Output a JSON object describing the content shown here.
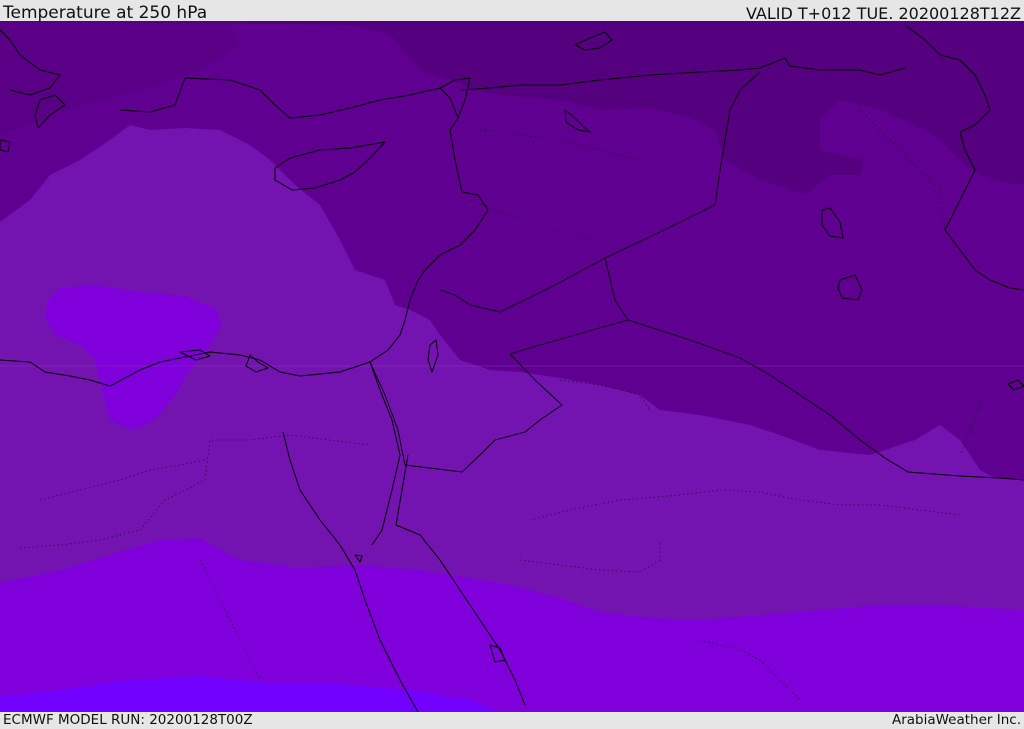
{
  "header": {
    "title": "Temperature at 250 hPa",
    "valid": "VALID T+012 TUE. 20200128T12Z"
  },
  "footer": {
    "model_run": "ECMWF MODEL RUN: 20200128T00Z",
    "credit": "ArabiaWeather Inc."
  },
  "colors": {
    "coldest": "#55007f",
    "cold": "#600090",
    "mid": "#7414b0",
    "warm": "#8000dc",
    "warmest": "#7200ff",
    "coastline": "#000000"
  }
}
